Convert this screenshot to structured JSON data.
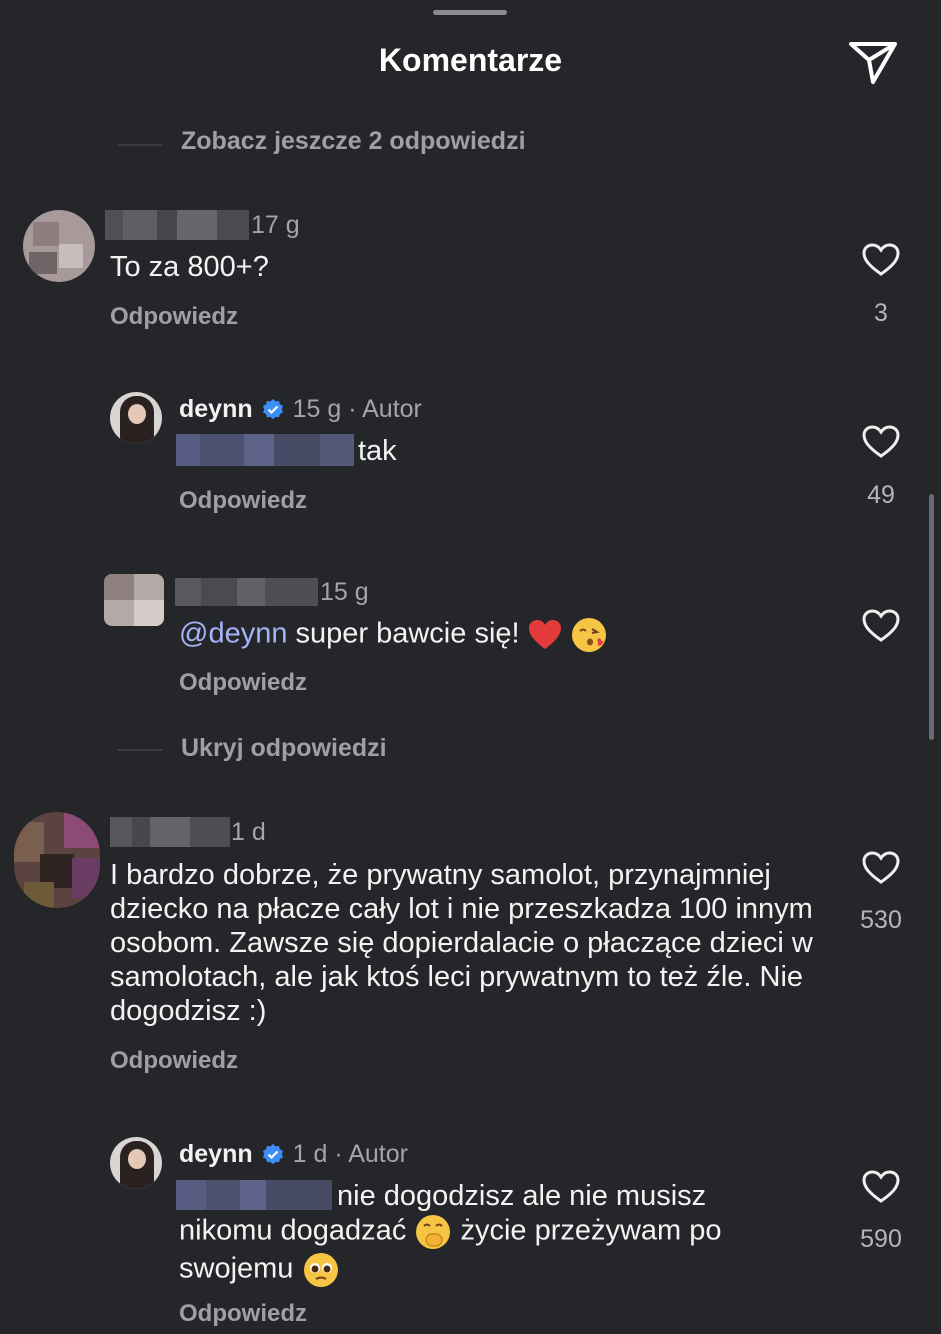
{
  "header": {
    "title": "Komentarze"
  },
  "thread_links": {
    "more_replies": "Zobacz jeszcze 2 odpowiedzi",
    "hide_replies": "Ukryj odpowiedzi"
  },
  "comments": [
    {
      "time": "17 g",
      "text": "To za 800+?",
      "reply": "Odpowiedz",
      "likes": "3"
    },
    {
      "username": "deynn",
      "time": "15 g · Autor",
      "text": "tak",
      "reply": "Odpowiedz",
      "likes": "49"
    },
    {
      "time": "15 g",
      "mention": "@deynn",
      "text": " super bawcie się!",
      "reply": "Odpowiedz"
    },
    {
      "time": "1 d",
      "text": "I bardzo dobrze, że prywatny samolot, przynajmniej dziecko na płacze cały lot i nie przeszkadza 100 innym osobom. Zawsze się dopierdalacie o płaczące dzieci w samolotach, ale jak ktoś leci prywatnym to też źle. Nie dogodzisz :)",
      "reply": "Odpowiedz",
      "likes": "530"
    },
    {
      "username": "deynn",
      "time": "1 d · Autor",
      "text_a": "nie dogodzisz ale nie musisz",
      "text_b": "nikomu dogadzać",
      "text_c": " życie przeżywam po",
      "text_d": "swojemu",
      "reply": "Odpowiedz",
      "likes": "590"
    }
  ],
  "colors": {
    "background": "#25262a",
    "verified": "#3d8ef7",
    "mention": "#a5b4f7"
  },
  "icons": [
    "send-icon",
    "heart-icon",
    "verified-badge-icon",
    "red-heart-emoji",
    "kiss-emoji",
    "hand-over-mouth-emoji",
    "pleading-face-emoji"
  ]
}
